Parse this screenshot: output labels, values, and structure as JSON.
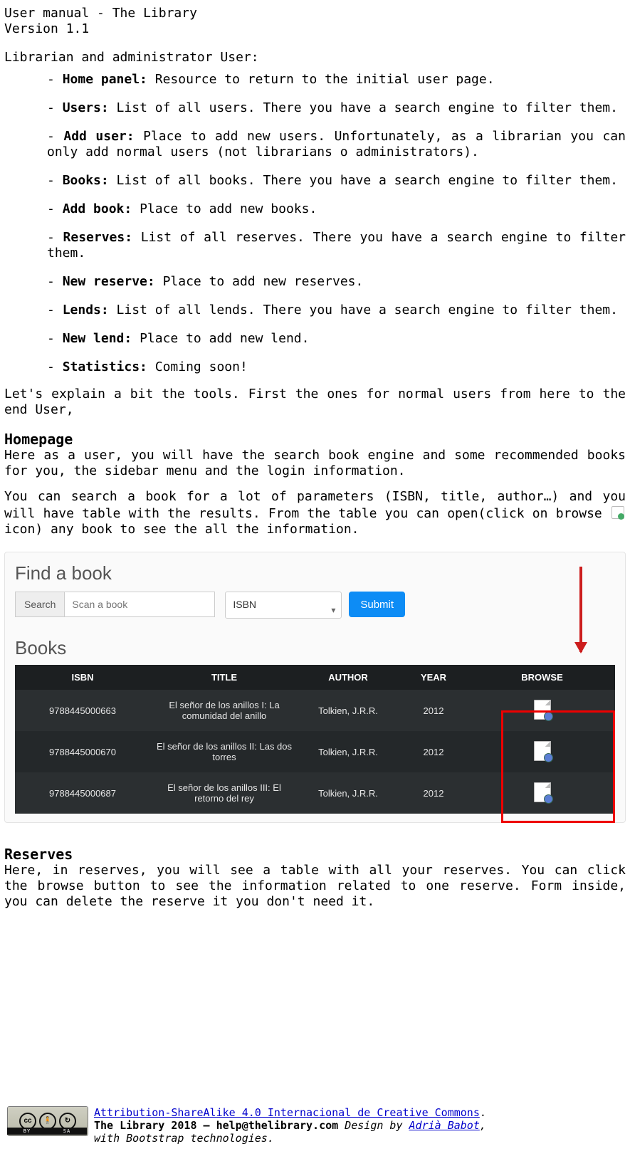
{
  "header": {
    "title": "User manual - The Library",
    "version": "Version 1.1"
  },
  "section_role": "Librarian and administrator User:",
  "bullets": [
    {
      "term": "Home panel:",
      "desc": " Resource to return to the initial user page."
    },
    {
      "term": "Users:",
      "desc": " List of all users. There you have a search engine to filter them."
    },
    {
      "term": "Add user:",
      "desc": " Place to add new users. Unfortunately, as a librarian you can only add normal users (not librarians o administrators)."
    },
    {
      "term": "Books:",
      "desc": " List of all books. There you have a search engine to filter them."
    },
    {
      "term": "Add book:",
      "desc": " Place to add new books."
    },
    {
      "term": "Reserves:",
      "desc": " List of all reserves. There you have a search engine to filter them."
    },
    {
      "term": "New reserve:",
      "desc": " Place to add new reserves."
    },
    {
      "term": "Lends:",
      "desc": " List of all lends. There you have a search engine to filter them."
    },
    {
      "term": "New lend:",
      "desc": " Place to add new lend."
    },
    {
      "term": "Statistics:",
      "desc": " Coming soon!"
    }
  ],
  "intro_para": "Let's explain a bit the tools. First the ones for normal users from here to the end User,",
  "homepage": {
    "heading": "Homepage",
    "p1": "Here as a user, you will have the search book engine and some recommended books for you, the sidebar menu and the login information.",
    "p2a": "You can search a book for a lot of parameters (ISBN, title, author…) and you will have table with the results. From the table you can open(click on browse ",
    "p2b": " icon) any book to see the all the information."
  },
  "screenshot": {
    "find_title": "Find a book",
    "search_label": "Search",
    "search_placeholder": "Scan a book",
    "select_value": "ISBN",
    "submit": "Submit",
    "books_title": "Books",
    "columns": {
      "c1": "ISBN",
      "c2": "TITLE",
      "c3": "AUTHOR",
      "c4": "YEAR",
      "c5": "BROWSE"
    },
    "rows": [
      {
        "isbn": "9788445000663",
        "title": "El señor de los anillos I: La comunidad del anillo",
        "author": "Tolkien, J.R.R.",
        "year": "2012"
      },
      {
        "isbn": "9788445000670",
        "title": "El señor de los anillos II: Las dos torres",
        "author": "Tolkien, J.R.R.",
        "year": "2012"
      },
      {
        "isbn": "9788445000687",
        "title": "El señor de los anillos III: El retorno del rey",
        "author": "Tolkien, J.R.R.",
        "year": "2012"
      }
    ]
  },
  "reserves": {
    "heading": "Reserves",
    "p": "Here, in reserves, you will see a table with all your reserves. You can click the browse button to see the information related to one reserve. Form inside, you can delete the reserve it you don't need it."
  },
  "footer": {
    "license_link": "Attribution-ShareAlike 4.0 Internacional de Creative Commons",
    "line2a": "The Library 2018 – help@thelibrary.com ",
    "line2b": "Design by ",
    "line2c": "Adrià Babot",
    "line3": "with Bootstrap technologies.",
    "cc_left": "CC",
    "cc_mid": "BY",
    "cc_right": "SA"
  }
}
